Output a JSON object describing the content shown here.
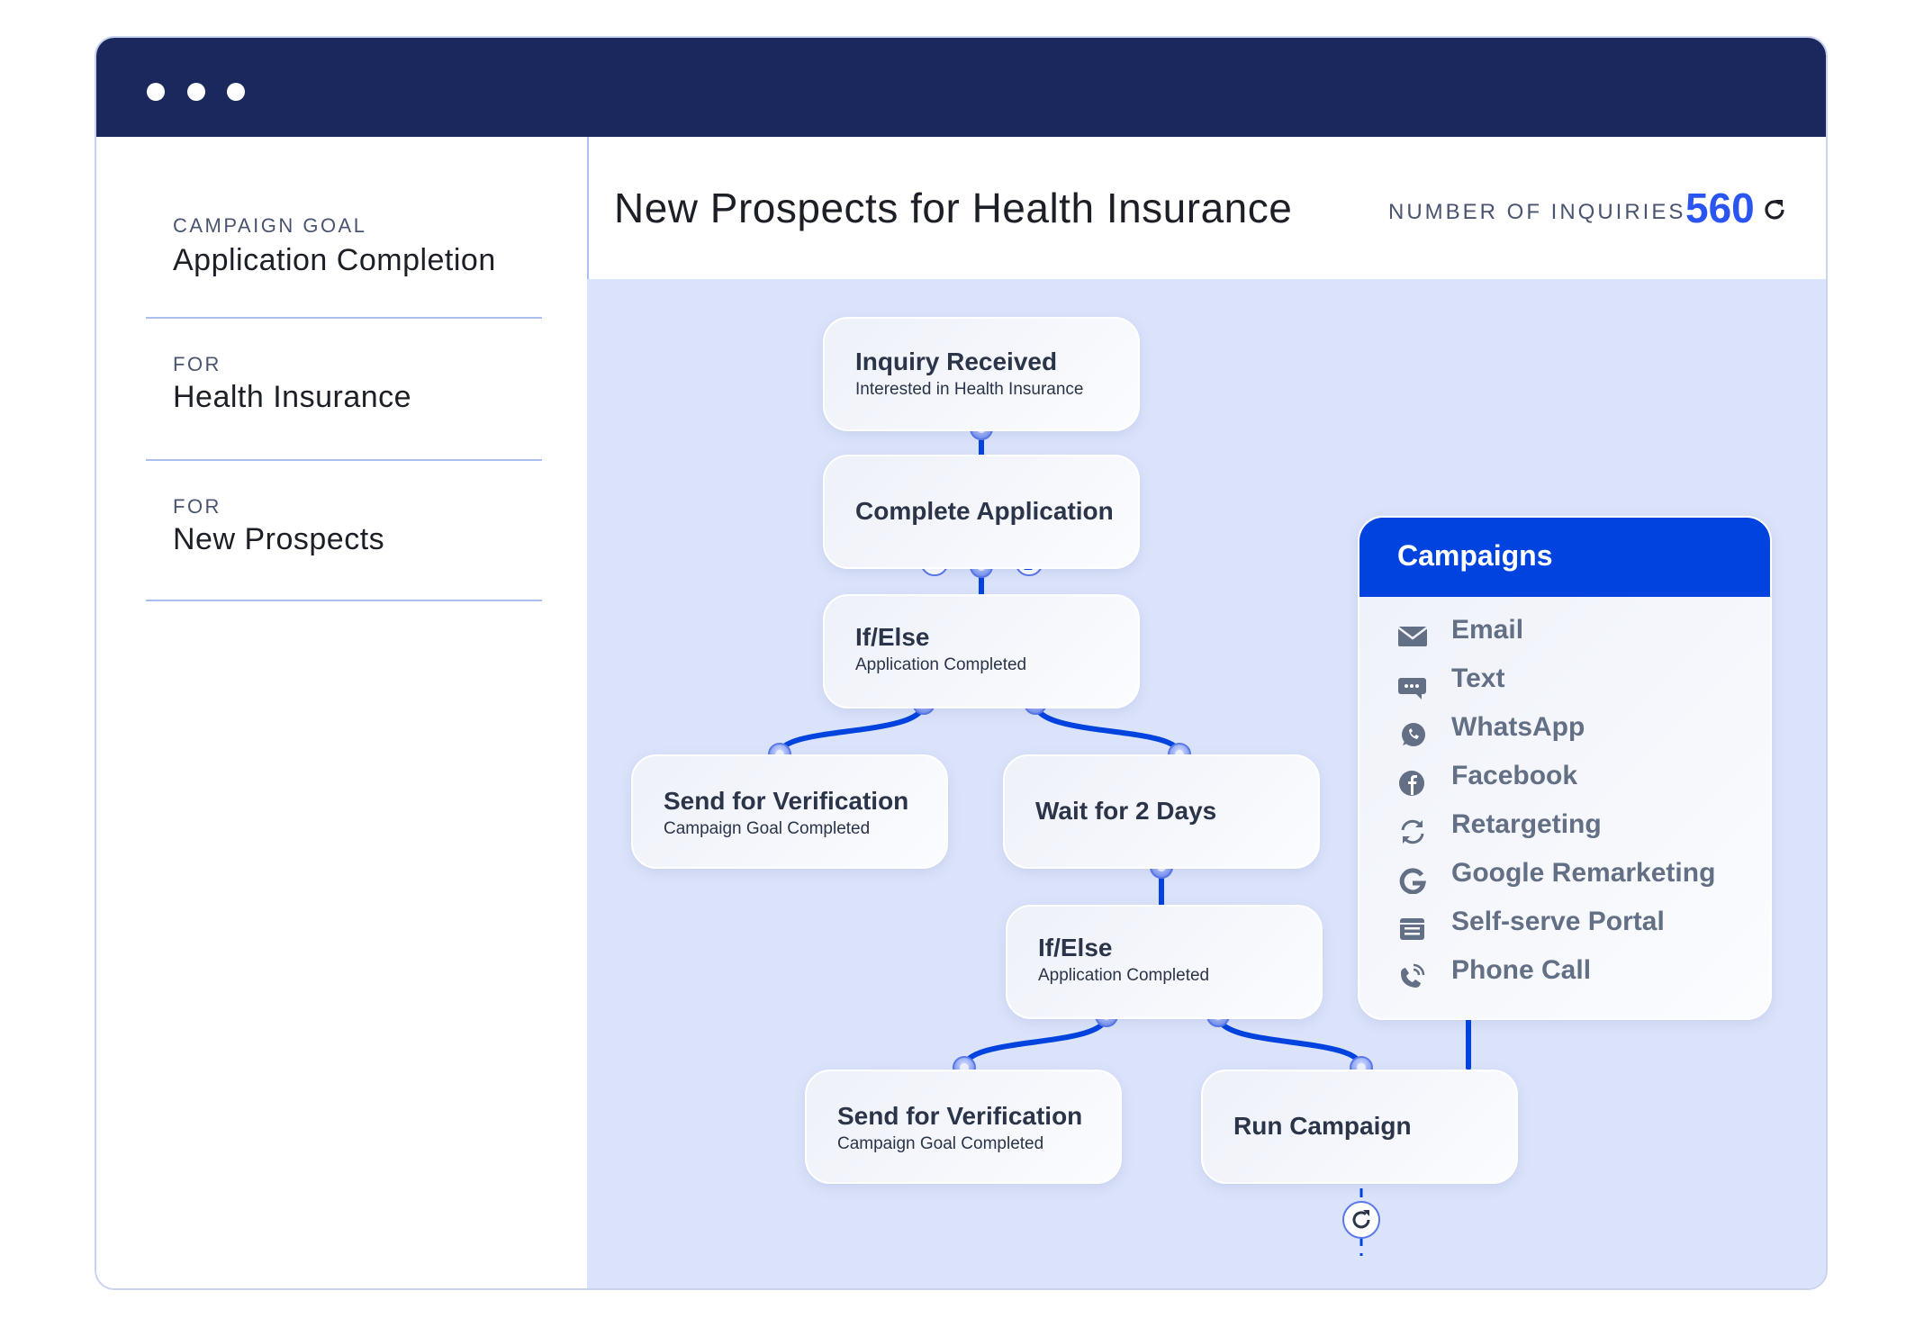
{
  "window": {
    "controls": [
      "dot",
      "dot",
      "dot"
    ]
  },
  "sidebar": {
    "sections": [
      {
        "label": "CAMPAIGN GOAL",
        "value": "Application Completion"
      },
      {
        "label": "FOR",
        "value": "Health Insurance"
      },
      {
        "label": "FOR",
        "value": "New Prospects"
      }
    ]
  },
  "header": {
    "title": "New Prospects for Health Insurance",
    "inquiries_label": "NUMBER OF INQUIRIES",
    "inquiries_value": "560",
    "refresh_icon": "refresh-icon"
  },
  "flow": {
    "nodes": [
      {
        "id": "inquiry",
        "title": "Inquiry Received",
        "subtitle": "Interested in Health Insurance"
      },
      {
        "id": "complete-app",
        "title": "Complete Application",
        "subtitle": "",
        "channel_icons": [
          "email-icon",
          "text-message-icon"
        ]
      },
      {
        "id": "ifelse-1",
        "title": "If/Else",
        "subtitle": "Application Completed"
      },
      {
        "id": "verify-1",
        "title": "Send for Verification",
        "subtitle": "Campaign Goal Completed"
      },
      {
        "id": "wait",
        "title": "Wait for 2 Days",
        "subtitle": ""
      },
      {
        "id": "ifelse-2",
        "title": "If/Else",
        "subtitle": "Application Completed"
      },
      {
        "id": "verify-2",
        "title": "Send for Verification",
        "subtitle": "Campaign Goal Completed"
      },
      {
        "id": "run",
        "title": "Run Campaign",
        "subtitle": ""
      }
    ],
    "loop_icon": "refresh-icon"
  },
  "campaigns": {
    "title": "Campaigns",
    "items": [
      {
        "label": "Email",
        "icon": "email-icon"
      },
      {
        "label": "Text",
        "icon": "text-message-icon"
      },
      {
        "label": "WhatsApp",
        "icon": "whatsapp-icon"
      },
      {
        "label": "Facebook",
        "icon": "facebook-icon"
      },
      {
        "label": "Retargeting",
        "icon": "retargeting-icon"
      },
      {
        "label": "Google Remarketing",
        "icon": "google-icon"
      },
      {
        "label": "Self-serve Portal",
        "icon": "portal-icon"
      },
      {
        "label": "Phone Call",
        "icon": "phone-call-icon"
      }
    ]
  },
  "colors": {
    "titlebar": "#1b285e",
    "accent": "#0043df",
    "count": "#2a55f0",
    "canvas": "#dbe3fb"
  }
}
